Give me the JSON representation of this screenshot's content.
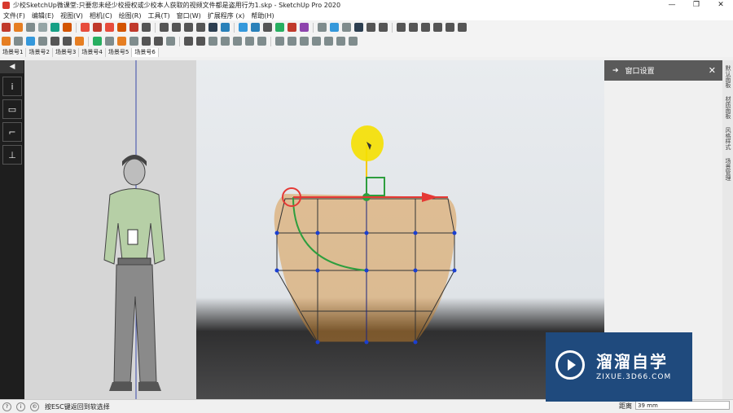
{
  "window": {
    "title": "少校SketchUp微课堂:只要您未经少校授权或少校本人获取的视频文件都是盗用行为1.skp - SketchUp Pro 2020",
    "controls": {
      "minimize": "—",
      "maximize": "❐",
      "close": "✕"
    }
  },
  "menu": [
    "文件(F)",
    "编辑(E)",
    "视图(V)",
    "相机(C)",
    "绘图(R)",
    "工具(T)",
    "窗口(W)",
    "扩展程序 (x)",
    "帮助(H)"
  ],
  "toolbar_colors": {
    "row1": [
      "#c0392b",
      "#e67e22",
      "#7f8c8d",
      "#95a5a6",
      "#16a085",
      "#d35400",
      "#e74c3c",
      "#c0392b",
      "#e74c3c",
      "#d35400",
      "#c0392b",
      "#555555",
      "#555555",
      "#555555",
      "#555555",
      "#555555",
      "#2c3e50",
      "#2980b9",
      "#3498db",
      "#2980b9",
      "#555555",
      "#27ae60",
      "#c0392b",
      "#8e44ad",
      "#7f8c8d",
      "#3498db",
      "#7f8c8d",
      "#2c3e50",
      "#555555",
      "#555555",
      "#555555",
      "#555555",
      "#555555",
      "#555555",
      "#555555",
      "#555555"
    ],
    "row2": [
      "#e67e22",
      "#7f8c8d",
      "#3498db",
      "#7f8c8d",
      "#555555",
      "#555555",
      "#e67e22",
      "#27ae60",
      "#7f8c8d",
      "#e67e22",
      "#7f8c8d",
      "#555555",
      "#555555",
      "#7f8c8d",
      "#555555",
      "#555555",
      "#7f8c8d",
      "#7f8c8d",
      "#7f8c8d",
      "#7f8c8d",
      "#7f8c8d",
      "#7f8c8d",
      "#7f8c8d",
      "#7f8c8d",
      "#7f8c8d",
      "#7f8c8d",
      "#7f8c8d",
      "#7f8c8d"
    ]
  },
  "scene_tabs": [
    "场景号1",
    "场景号2",
    "场景号3",
    "场景号4",
    "场景号5",
    "场景号6"
  ],
  "active_scene": 5,
  "left_tools": {
    "header": "◀",
    "expand": "›",
    "items": [
      {
        "icon": "info-icon",
        "glyph": "i"
      },
      {
        "icon": "rectangle-icon",
        "glyph": "▭"
      },
      {
        "icon": "arc-tool-icon",
        "glyph": "⌐"
      },
      {
        "icon": "axes-icon",
        "glyph": "⊥"
      }
    ]
  },
  "right_panel": {
    "title": "窗口设置",
    "arrow": "➔",
    "close": "✕"
  },
  "vertical_tabs": [
    "默认面板",
    "材质面板",
    "风格样式",
    "场景管理"
  ],
  "status": {
    "icons": [
      "?",
      "i",
      "©"
    ],
    "text": "按ESC键返回到软选择",
    "measure_label": "距离",
    "measure_value": "39 mm"
  },
  "watermark": {
    "main": "溜溜自学",
    "sub": "ZIXUE.3D66.COM"
  },
  "colors": {
    "axis_red": "#e53935",
    "axis_green": "#2e9e3e",
    "axis_blue": "#1a237e",
    "highlight": "#f5e000",
    "liquid": "#d68a2a"
  }
}
